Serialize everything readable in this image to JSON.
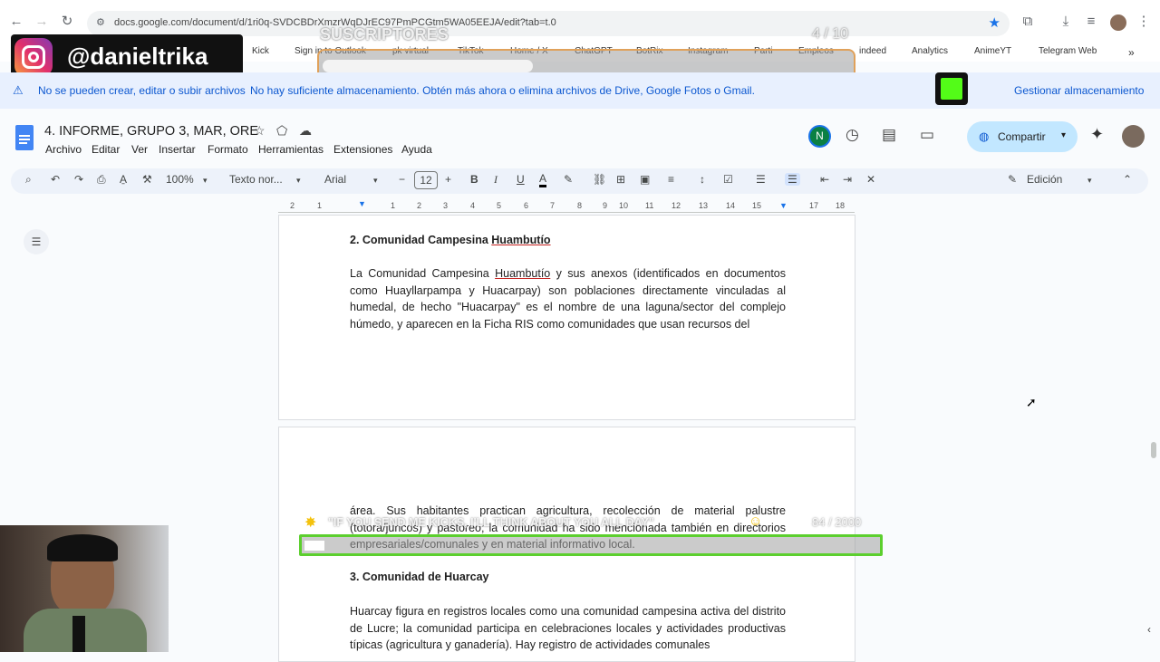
{
  "browser": {
    "url": "docs.google.com/document/d/1ri0q-SVDCBDrXmzrWqDJrEC97PmPCGtm5WA05EEJA/edit?tab=t.0"
  },
  "bookmarks": [
    "Kick",
    "Sign in to Outlook",
    "pk virtual",
    "TikTok",
    "Home / X",
    "ChatGPT",
    "BotRix",
    "Instagram",
    "Parti",
    "Empleos",
    "indeed",
    "Analytics",
    "AnimeYT",
    "Telegram Web"
  ],
  "stream_overlay": {
    "subs_label": "SUSCRIPTORES",
    "subs_count": "4 / 10",
    "instagram_handle": "@danieltrika",
    "ticker_text": "\"IF YOU SEND ME KICKS, I'LL THINK ABOUT YOU ALL DAY\"",
    "ticker_count": "84 / 2000"
  },
  "banner": {
    "title": "No se pueden crear, editar o subir archivos",
    "message": "No hay suficiente almacenamiento. Obtén más ahora o elimina archivos de Drive, Google Fotos o Gmail.",
    "action": "Gestionar almacenamiento"
  },
  "doc": {
    "title": "4. INFORME, GRUPO 3, MAR, ORE",
    "menus": [
      "Archivo",
      "Editar",
      "Ver",
      "Insertar",
      "Formato",
      "Herramientas",
      "Extensiones",
      "Ayuda"
    ],
    "avatar_letter": "N",
    "share_label": "Compartir",
    "mode_label": "Edición"
  },
  "toolbar": {
    "zoom": "100%",
    "style": "Texto nor...",
    "font": "Arial",
    "font_size": "12"
  },
  "ruler_marks": [
    "2",
    "1",
    "1",
    "2",
    "3",
    "4",
    "5",
    "6",
    "7",
    "8",
    "9",
    "10",
    "11",
    "12",
    "13",
    "14",
    "15",
    "16",
    "17",
    "18"
  ],
  "page1": {
    "heading_prefix": "2. Comunidad Campesina ",
    "heading_name": "Huambutío",
    "para_prefix": "La Comunidad Campesina ",
    "para_name": "Huambutío",
    "para_rest": " y sus anexos (identificados en documentos como Huayllarpampa y Huacarpay) son poblaciones directamente vinculadas al humedal, de hecho \"Huacarpay\" es el nombre de una laguna/sector del complejo húmedo, y aparecen en la Ficha RIS como comunidades que usan recursos del"
  },
  "page2": {
    "para1": "área. Sus habitantes practican agricultura, recolección de material palustre (totora/juncos) y pastoreo; la comunidad ha sido mencionada también en directorios empresariales/comunales y en material informativo local.",
    "heading": "3. Comunidad de Huarcay",
    "para2": "Huarcay figura en registros locales como una comunidad campesina activa del distrito de Lucre; la comunidad participa en celebraciones locales y actividades productivas típicas (agricultura y ganadería). Hay registro de actividades comunales"
  }
}
